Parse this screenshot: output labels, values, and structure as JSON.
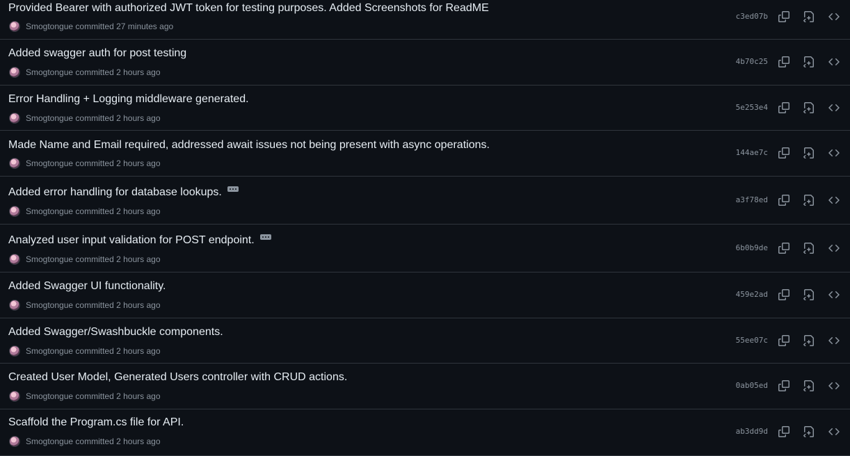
{
  "commits": [
    {
      "message": "Provided Bearer with authorized JWT token for testing purposes. Added Screenshots for ReadME",
      "author": "Smogtongue",
      "action": "committed",
      "time": "27 minutes ago",
      "sha": "c3ed07b",
      "has_more": false
    },
    {
      "message": "Added swagger auth for post testing",
      "author": "Smogtongue",
      "action": "committed",
      "time": "2 hours ago",
      "sha": "4b70c25",
      "has_more": false
    },
    {
      "message": "Error Handling + Logging middleware generated.",
      "author": "Smogtongue",
      "action": "committed",
      "time": "2 hours ago",
      "sha": "5e253e4",
      "has_more": false
    },
    {
      "message": "Made Name and Email required, addressed await issues not being present with async operations.",
      "author": "Smogtongue",
      "action": "committed",
      "time": "2 hours ago",
      "sha": "144ae7c",
      "has_more": false
    },
    {
      "message": "Added error handling for database lookups.",
      "author": "Smogtongue",
      "action": "committed",
      "time": "2 hours ago",
      "sha": "a3f78ed",
      "has_more": true
    },
    {
      "message": "Analyzed user input validation for POST endpoint.",
      "author": "Smogtongue",
      "action": "committed",
      "time": "2 hours ago",
      "sha": "6b0b9de",
      "has_more": true
    },
    {
      "message": "Added Swagger UI functionality.",
      "author": "Smogtongue",
      "action": "committed",
      "time": "2 hours ago",
      "sha": "459e2ad",
      "has_more": false
    },
    {
      "message": "Added Swagger/Swashbuckle components.",
      "author": "Smogtongue",
      "action": "committed",
      "time": "2 hours ago",
      "sha": "55ee07c",
      "has_more": false
    },
    {
      "message": "Created User Model, Generated Users controller with CRUD actions.",
      "author": "Smogtongue",
      "action": "committed",
      "time": "2 hours ago",
      "sha": "0ab05ed",
      "has_more": false
    },
    {
      "message": "Scaffold the Program.cs file for API.",
      "author": "Smogtongue",
      "action": "committed",
      "time": "2 hours ago",
      "sha": "ab3dd9d",
      "has_more": false
    }
  ],
  "icons": {
    "copy": "copy-icon",
    "browse": "file-diff-icon",
    "code": "code-icon",
    "more": "kebab-horizontal-icon"
  },
  "colors": {
    "background": "#0d1117",
    "border": "#30363d",
    "text_primary": "#e6edf3",
    "text_muted": "#8b949e"
  }
}
